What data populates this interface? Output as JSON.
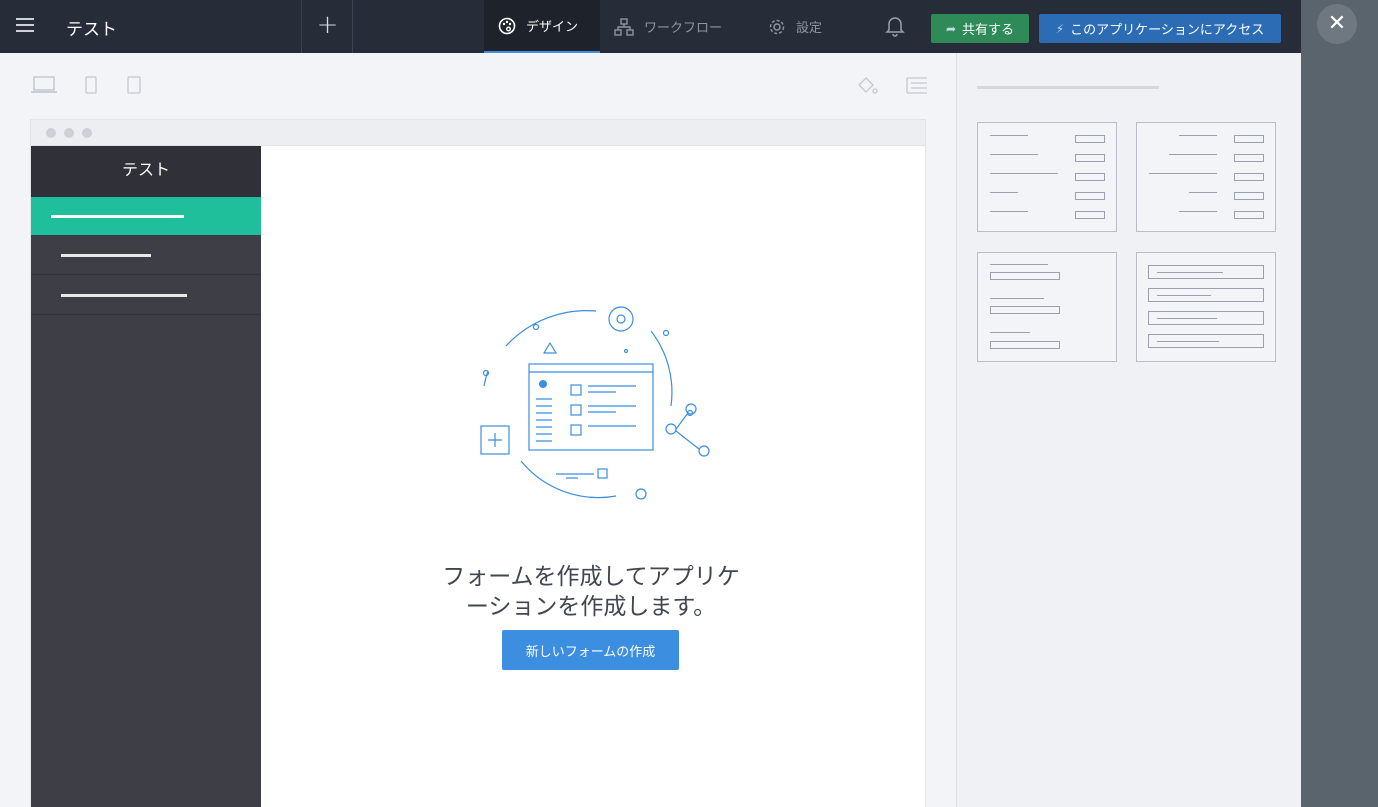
{
  "topbar": {
    "app_title": "テスト",
    "tabs": [
      {
        "label": "デザイン",
        "icon": "palette-icon",
        "active": true
      },
      {
        "label": "ワークフロー",
        "icon": "workflow-icon",
        "active": false
      },
      {
        "label": "設定",
        "icon": "gear-icon",
        "active": false
      }
    ],
    "share_label": "共有する",
    "access_label": "このアプリケーションにアクセス"
  },
  "preview": {
    "app_name": "テスト",
    "empty_message_line1": "フォームを作成してアプリケ",
    "empty_message_line2": "ーションを作成します。",
    "create_form_label": "新しいフォームの作成"
  },
  "colors": {
    "topbar": "#272d38",
    "accent_blue": "#3b8ee0",
    "share_green": "#2e8b57",
    "access_blue": "#2b6cb5",
    "active_menu": "#1fbf9b"
  }
}
